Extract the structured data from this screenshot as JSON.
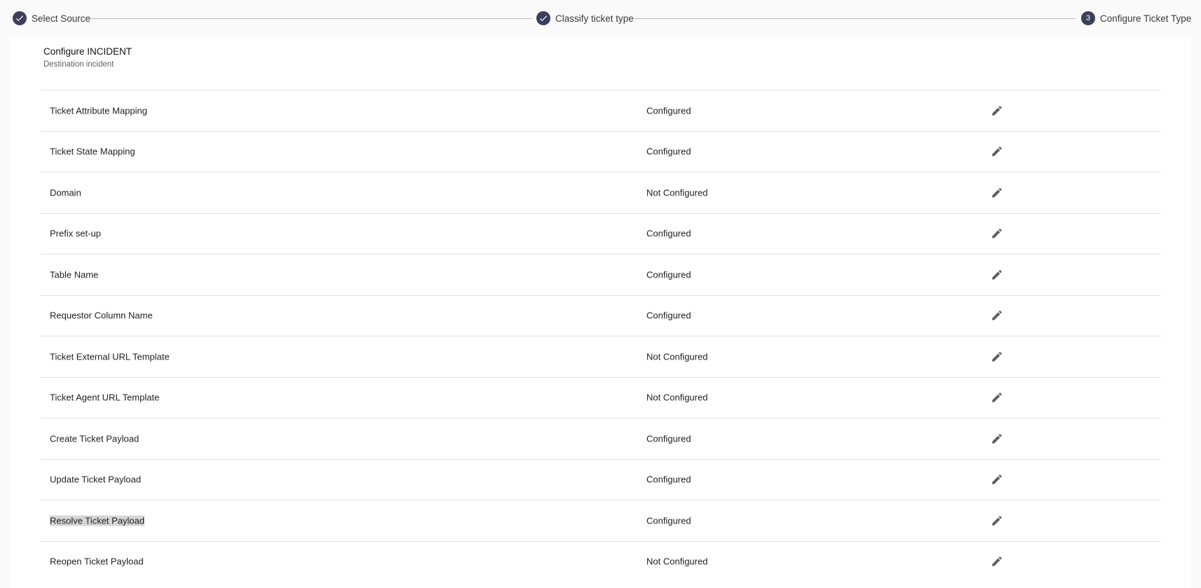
{
  "stepper": {
    "steps": [
      {
        "label": "Select Source",
        "state": "completed",
        "icon": "check-icon"
      },
      {
        "label": "Classify ticket type",
        "state": "completed",
        "icon": "check-icon"
      },
      {
        "label": "Configure Ticket Type",
        "state": "active",
        "number": "3"
      }
    ]
  },
  "card": {
    "title": "Configure INCIDENT",
    "subtitle": "Destination incident"
  },
  "rows": [
    {
      "name": "Ticket Attribute Mapping",
      "status": "Configured",
      "icon": "pencil-edit-icon"
    },
    {
      "name": "Ticket State Mapping",
      "status": "Configured",
      "icon": "pencil-edit-icon"
    },
    {
      "name": "Domain",
      "status": "Not Configured",
      "icon": "pencil-edit-icon"
    },
    {
      "name": "Prefix set-up",
      "status": "Configured",
      "icon": "pencil-edit-icon"
    },
    {
      "name": "Table Name",
      "status": "Configured",
      "icon": "pencil-edit-icon"
    },
    {
      "name": "Requestor Column Name",
      "status": "Configured",
      "icon": "pencil-edit-icon"
    },
    {
      "name": "Ticket External URL Template",
      "status": "Not Configured",
      "icon": "pencil-edit-icon"
    },
    {
      "name": "Ticket Agent URL Template",
      "status": "Not Configured",
      "icon": "pencil-edit-icon"
    },
    {
      "name": "Create Ticket Payload",
      "status": "Configured",
      "icon": "pencil-edit-icon"
    },
    {
      "name": "Update Ticket Payload",
      "status": "Configured",
      "icon": "pencil-edit-icon"
    },
    {
      "name": "Resolve Ticket Payload",
      "status": "Configured",
      "icon": "pencil-edit-icon",
      "selected": true
    },
    {
      "name": "Reopen Ticket Payload",
      "status": "Not Configured",
      "icon": "pencil-edit-icon"
    }
  ],
  "colors": {
    "step_circle": "#3d3d5c",
    "page_background": "#fafafa",
    "card_background": "#ffffff",
    "divider": "#e0e0e0",
    "selection_highlight": "#d6d6d6"
  }
}
